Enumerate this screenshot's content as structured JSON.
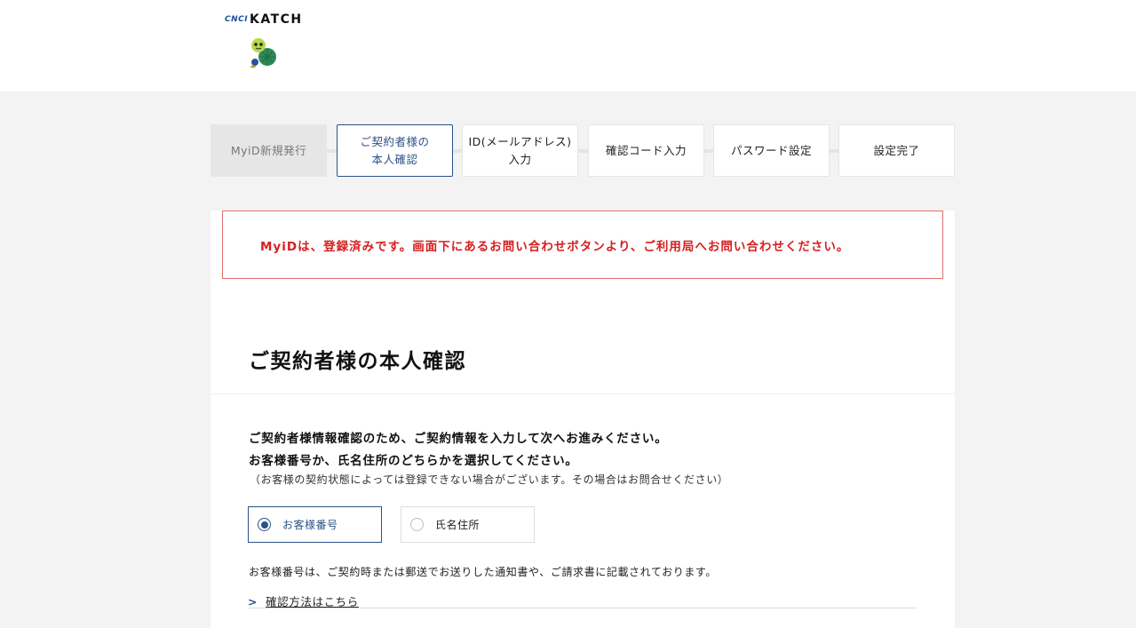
{
  "header": {
    "logo_small": "CNCI",
    "logo_main": "KATCH"
  },
  "steps": [
    {
      "label": "MyiD新規発行",
      "state": "done"
    },
    {
      "label": "ご契約者様の\n本人確認",
      "state": "active"
    },
    {
      "label": "ID(メールアドレス)\n入力",
      "state": "pending"
    },
    {
      "label": "確認コード入力",
      "state": "pending"
    },
    {
      "label": "パスワード設定",
      "state": "pending"
    },
    {
      "label": "設定完了",
      "state": "pending"
    }
  ],
  "alert": {
    "message": "MyiDは、登録済みです。画面下にあるお問い合わせボタンより、ご利用局へお問い合わせください。",
    "color": "#d61f1f"
  },
  "section": {
    "title": "ご契約者様の本人確認",
    "instruction1": "ご契約者様情報確認のため、ご契約情報を入力して次へお進みください。",
    "instruction2": "お客様番号か、氏名住所のどちらかを選択してください。",
    "note": "（お客様の契約状態によっては登録できない場合がございます。その場合はお問合せください）"
  },
  "options": [
    {
      "label": "お客様番号",
      "selected": true
    },
    {
      "label": "氏名住所",
      "selected": false
    }
  ],
  "description": "お客様番号は、ご契約時または郵送でお送りした通知書や、ご請求書に記載されております。",
  "link": {
    "chevron": ">",
    "label": "確認方法はこちら"
  },
  "colors": {
    "accent": "#2c5286",
    "background": "#f3f3f3"
  }
}
